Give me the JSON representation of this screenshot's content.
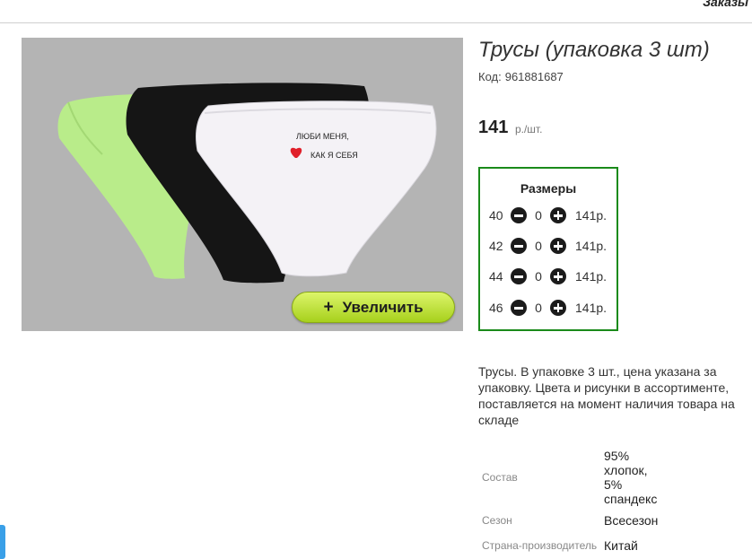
{
  "header": {
    "orders_label": "Заказы"
  },
  "product": {
    "title": "Трусы (упаковка 3 шт)",
    "code_label": "Код:",
    "code_value": "961881687",
    "price": "141",
    "price_unit": "р./шт.",
    "zoom_button_label": "Увеличить",
    "image_print_text_line1": "ЛЮБИ МЕНЯ,",
    "image_print_text_line2": "КАК Я СЕБЯ",
    "description": "Трусы. В упаковке 3 шт., цена указана за упаковку. Цвета и рисунки в ассортименте, поставляется на момент наличия товара на складе"
  },
  "sizes": {
    "title": "Размеры",
    "rows": [
      {
        "size": "40",
        "qty": "0",
        "price": "141р."
      },
      {
        "size": "42",
        "qty": "0",
        "price": "141р."
      },
      {
        "size": "44",
        "qty": "0",
        "price": "141р."
      },
      {
        "size": "46",
        "qty": "0",
        "price": "141р."
      }
    ]
  },
  "attributes": {
    "composition_label": "Состав",
    "composition_value": "95% хлопок, 5% спандекс",
    "season_label": "Сезон",
    "season_value": "Всесезон",
    "country_label": "Страна-производитель",
    "country_value": "Китай"
  },
  "colors": {
    "sizes_border": "#1a8a1a",
    "zoom_button": "#b8dd2c",
    "image_background": "#b4b4b4"
  }
}
